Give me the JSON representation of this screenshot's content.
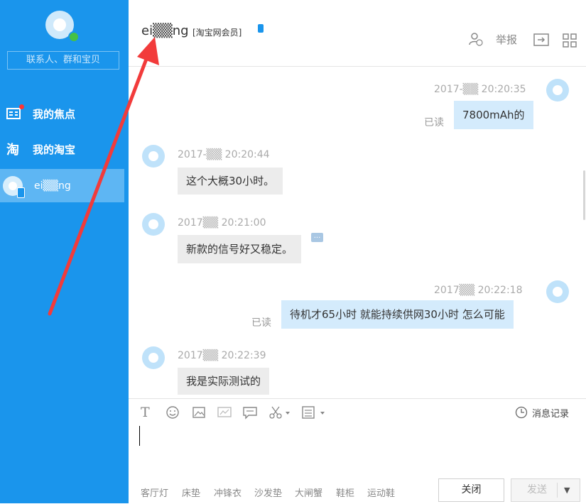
{
  "sidebar": {
    "search_placeholder": "联系人、群和宝贝",
    "items": [
      {
        "label": "我的焦点"
      },
      {
        "label": "我的淘宝"
      }
    ],
    "active_contact": "ei▒▒ng"
  },
  "header": {
    "contact_name": "ei▒▒ng",
    "tag": "[淘宝网会员]",
    "report_label": "举报"
  },
  "messages": [
    {
      "direction": "out",
      "time": "2017-▒▒ 20:20:35",
      "text": "7800mAh的",
      "status": "已读"
    },
    {
      "direction": "in",
      "sender": "ei▒▒ng",
      "time": "2017-▒▒ 20:20:44",
      "text": "这个大概30小时。"
    },
    {
      "direction": "in",
      "sender": "ei▒▒ng",
      "time": "2017▒▒ 20:21:00",
      "text": "新款的信号好又稳定。"
    },
    {
      "direction": "out",
      "time": "2017▒▒ 20:22:18",
      "text": "待机才65小时   就能持续供网30小时  怎么可能",
      "status": "已读"
    },
    {
      "direction": "in",
      "sender": "ei▒▒ng",
      "time": "2017▒▒ 20:22:39",
      "text": "我是实际测试的"
    }
  ],
  "composer": {
    "history_label": "消息记录",
    "hot_words": [
      "客厅灯",
      "床垫",
      "冲锋衣",
      "沙发垫",
      "大闸蟹",
      "鞋柜",
      "运动鞋"
    ],
    "close_label": "关闭",
    "send_label": "发送"
  },
  "colors": {
    "sidebar_bg": "#1a95ec",
    "outgoing_bubble": "#d4ebfc",
    "incoming_bubble": "#ececec",
    "annotation_arrow": "#f23b3b"
  }
}
